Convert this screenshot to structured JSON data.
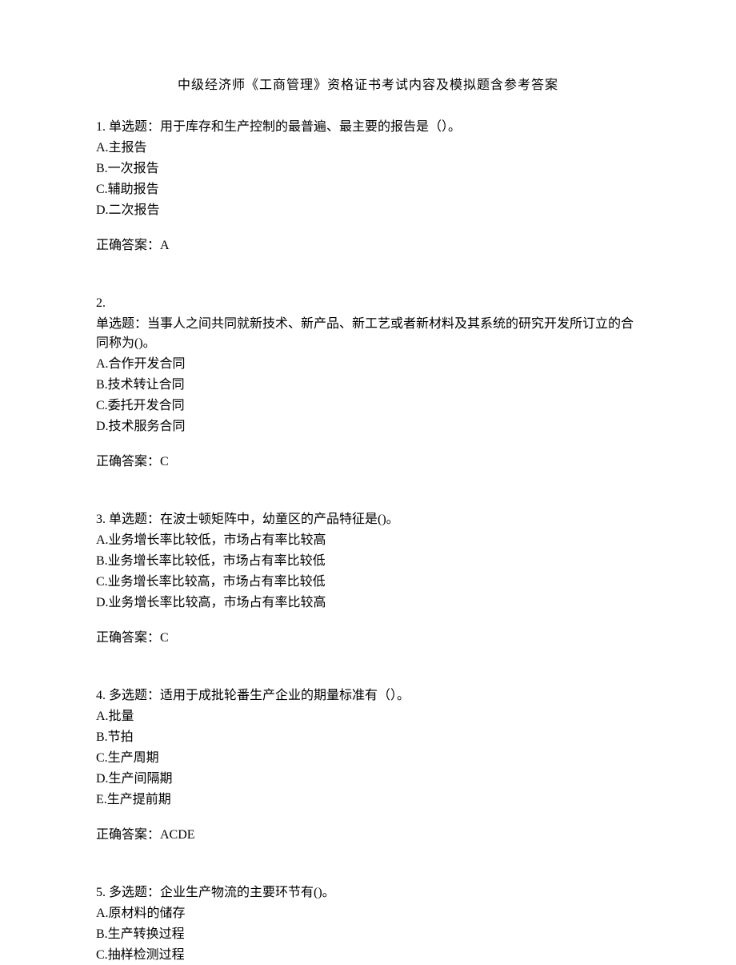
{
  "title": "中级经济师《工商管理》资格证书考试内容及模拟题含参考答案",
  "questions": [
    {
      "number": "1. ",
      "stem": "单选题：用于库存和生产控制的最普遍、最主要的报告是（）。",
      "options": [
        "A.主报告",
        "B.一次报告",
        "C.辅助报告",
        "D.二次报告"
      ],
      "answer": "正确答案：A"
    },
    {
      "number": "2.",
      "stem": "单选题：当事人之间共同就新技术、新产品、新工艺或者新材料及其系统的研究开发所订立的合同称为()。",
      "options": [
        "A.合作开发合同",
        "B.技术转让合同",
        "C.委托开发合同",
        "D.技术服务合同"
      ],
      "answer": "正确答案：C"
    },
    {
      "number": "3. ",
      "stem": "单选题：在波士顿矩阵中，幼童区的产品特征是()。",
      "options": [
        "A.业务增长率比较低，市场占有率比较高",
        "B.业务增长率比较低，市场占有率比较低",
        "C.业务增长率比较高，市场占有率比较低",
        "D.业务增长率比较高，市场占有率比较高"
      ],
      "answer": "正确答案：C"
    },
    {
      "number": "4. ",
      "stem": "多选题：适用于成批轮番生产企业的期量标准有（）。",
      "options": [
        "A.批量",
        "B.节拍",
        "C.生产周期",
        "D.生产间隔期",
        "E.生产提前期"
      ],
      "answer": "正确答案：ACDE"
    },
    {
      "number": "5. ",
      "stem": "多选题：企业生产物流的主要环节有()。",
      "options": [
        "A.原材料的储存",
        "B.生产转换过程",
        "C.抽样检测过程"
      ],
      "answer": ""
    }
  ]
}
